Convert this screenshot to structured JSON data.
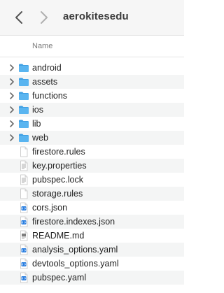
{
  "window": {
    "title": "aerokitesedu"
  },
  "header": {
    "name_column": "Name"
  },
  "items": [
    {
      "name": "android",
      "kind": "folder",
      "icon": "folder-icon"
    },
    {
      "name": "assets",
      "kind": "folder",
      "icon": "folder-icon"
    },
    {
      "name": "functions",
      "kind": "folder",
      "icon": "folder-icon"
    },
    {
      "name": "ios",
      "kind": "folder",
      "icon": "folder-icon"
    },
    {
      "name": "lib",
      "kind": "folder",
      "icon": "folder-icon"
    },
    {
      "name": "web",
      "kind": "folder",
      "icon": "folder-icon"
    },
    {
      "name": "firestore.rules",
      "kind": "file",
      "icon": "blank-document-icon"
    },
    {
      "name": "key.properties",
      "kind": "file",
      "icon": "text-document-icon"
    },
    {
      "name": "pubspec.lock",
      "kind": "file",
      "icon": "text-document-icon"
    },
    {
      "name": "storage.rules",
      "kind": "file",
      "icon": "blank-document-icon"
    },
    {
      "name": "cors.json",
      "kind": "file",
      "icon": "code-document-icon"
    },
    {
      "name": "firestore.indexes.json",
      "kind": "file",
      "icon": "code-document-icon"
    },
    {
      "name": "README.md",
      "kind": "file",
      "icon": "markdown-document-icon"
    },
    {
      "name": "analysis_options.yaml",
      "kind": "file",
      "icon": "code-document-icon"
    },
    {
      "name": "devtools_options.yaml",
      "kind": "file",
      "icon": "code-document-icon"
    },
    {
      "name": "pubspec.yaml",
      "kind": "file",
      "icon": "code-document-icon"
    }
  ],
  "colors": {
    "folder": "#5ab5f0",
    "folder_tab": "#3f9fe3",
    "code_badge": "#2b7fe0",
    "row_alt": "#f4f5f5"
  }
}
